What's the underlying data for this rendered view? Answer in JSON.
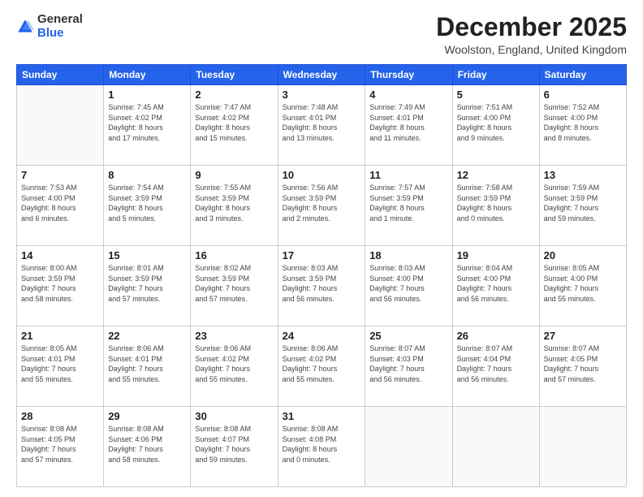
{
  "logo": {
    "general": "General",
    "blue": "Blue"
  },
  "header": {
    "title": "December 2025",
    "location": "Woolston, England, United Kingdom"
  },
  "days_of_week": [
    "Sunday",
    "Monday",
    "Tuesday",
    "Wednesday",
    "Thursday",
    "Friday",
    "Saturday"
  ],
  "weeks": [
    [
      {
        "day": "",
        "info": ""
      },
      {
        "day": "1",
        "info": "Sunrise: 7:45 AM\nSunset: 4:02 PM\nDaylight: 8 hours\nand 17 minutes."
      },
      {
        "day": "2",
        "info": "Sunrise: 7:47 AM\nSunset: 4:02 PM\nDaylight: 8 hours\nand 15 minutes."
      },
      {
        "day": "3",
        "info": "Sunrise: 7:48 AM\nSunset: 4:01 PM\nDaylight: 8 hours\nand 13 minutes."
      },
      {
        "day": "4",
        "info": "Sunrise: 7:49 AM\nSunset: 4:01 PM\nDaylight: 8 hours\nand 11 minutes."
      },
      {
        "day": "5",
        "info": "Sunrise: 7:51 AM\nSunset: 4:00 PM\nDaylight: 8 hours\nand 9 minutes."
      },
      {
        "day": "6",
        "info": "Sunrise: 7:52 AM\nSunset: 4:00 PM\nDaylight: 8 hours\nand 8 minutes."
      }
    ],
    [
      {
        "day": "7",
        "info": "Sunrise: 7:53 AM\nSunset: 4:00 PM\nDaylight: 8 hours\nand 6 minutes."
      },
      {
        "day": "8",
        "info": "Sunrise: 7:54 AM\nSunset: 3:59 PM\nDaylight: 8 hours\nand 5 minutes."
      },
      {
        "day": "9",
        "info": "Sunrise: 7:55 AM\nSunset: 3:59 PM\nDaylight: 8 hours\nand 3 minutes."
      },
      {
        "day": "10",
        "info": "Sunrise: 7:56 AM\nSunset: 3:59 PM\nDaylight: 8 hours\nand 2 minutes."
      },
      {
        "day": "11",
        "info": "Sunrise: 7:57 AM\nSunset: 3:59 PM\nDaylight: 8 hours\nand 1 minute."
      },
      {
        "day": "12",
        "info": "Sunrise: 7:58 AM\nSunset: 3:59 PM\nDaylight: 8 hours\nand 0 minutes."
      },
      {
        "day": "13",
        "info": "Sunrise: 7:59 AM\nSunset: 3:59 PM\nDaylight: 7 hours\nand 59 minutes."
      }
    ],
    [
      {
        "day": "14",
        "info": "Sunrise: 8:00 AM\nSunset: 3:59 PM\nDaylight: 7 hours\nand 58 minutes."
      },
      {
        "day": "15",
        "info": "Sunrise: 8:01 AM\nSunset: 3:59 PM\nDaylight: 7 hours\nand 57 minutes."
      },
      {
        "day": "16",
        "info": "Sunrise: 8:02 AM\nSunset: 3:59 PM\nDaylight: 7 hours\nand 57 minutes."
      },
      {
        "day": "17",
        "info": "Sunrise: 8:03 AM\nSunset: 3:59 PM\nDaylight: 7 hours\nand 56 minutes."
      },
      {
        "day": "18",
        "info": "Sunrise: 8:03 AM\nSunset: 4:00 PM\nDaylight: 7 hours\nand 56 minutes."
      },
      {
        "day": "19",
        "info": "Sunrise: 8:04 AM\nSunset: 4:00 PM\nDaylight: 7 hours\nand 56 minutes."
      },
      {
        "day": "20",
        "info": "Sunrise: 8:05 AM\nSunset: 4:00 PM\nDaylight: 7 hours\nand 55 minutes."
      }
    ],
    [
      {
        "day": "21",
        "info": "Sunrise: 8:05 AM\nSunset: 4:01 PM\nDaylight: 7 hours\nand 55 minutes."
      },
      {
        "day": "22",
        "info": "Sunrise: 8:06 AM\nSunset: 4:01 PM\nDaylight: 7 hours\nand 55 minutes."
      },
      {
        "day": "23",
        "info": "Sunrise: 8:06 AM\nSunset: 4:02 PM\nDaylight: 7 hours\nand 55 minutes."
      },
      {
        "day": "24",
        "info": "Sunrise: 8:06 AM\nSunset: 4:02 PM\nDaylight: 7 hours\nand 55 minutes."
      },
      {
        "day": "25",
        "info": "Sunrise: 8:07 AM\nSunset: 4:03 PM\nDaylight: 7 hours\nand 56 minutes."
      },
      {
        "day": "26",
        "info": "Sunrise: 8:07 AM\nSunset: 4:04 PM\nDaylight: 7 hours\nand 56 minutes."
      },
      {
        "day": "27",
        "info": "Sunrise: 8:07 AM\nSunset: 4:05 PM\nDaylight: 7 hours\nand 57 minutes."
      }
    ],
    [
      {
        "day": "28",
        "info": "Sunrise: 8:08 AM\nSunset: 4:05 PM\nDaylight: 7 hours\nand 57 minutes."
      },
      {
        "day": "29",
        "info": "Sunrise: 8:08 AM\nSunset: 4:06 PM\nDaylight: 7 hours\nand 58 minutes."
      },
      {
        "day": "30",
        "info": "Sunrise: 8:08 AM\nSunset: 4:07 PM\nDaylight: 7 hours\nand 59 minutes."
      },
      {
        "day": "31",
        "info": "Sunrise: 8:08 AM\nSunset: 4:08 PM\nDaylight: 8 hours\nand 0 minutes."
      },
      {
        "day": "",
        "info": ""
      },
      {
        "day": "",
        "info": ""
      },
      {
        "day": "",
        "info": ""
      }
    ]
  ]
}
